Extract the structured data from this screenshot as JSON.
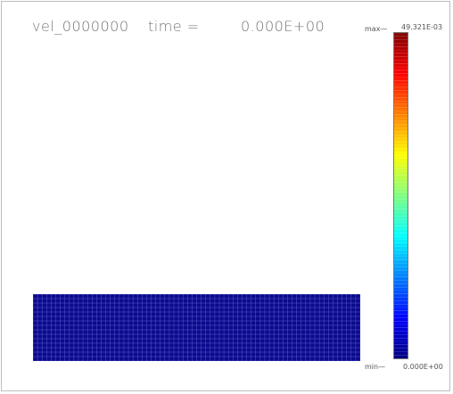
{
  "header": {
    "variable_name": "vel_0000000",
    "time_label": "time =",
    "time_value": "0.000E+00"
  },
  "colorbar": {
    "max_label": "max—",
    "max_value": "49.321E-03",
    "min_label": "min—",
    "min_value": "0.000E+00",
    "colormap": "jet",
    "bands": 96
  },
  "mesh": {
    "fill_color": "#0a0a8c",
    "grid_line_color": "#5a5ad0",
    "columns": 72,
    "rows": 15
  }
}
